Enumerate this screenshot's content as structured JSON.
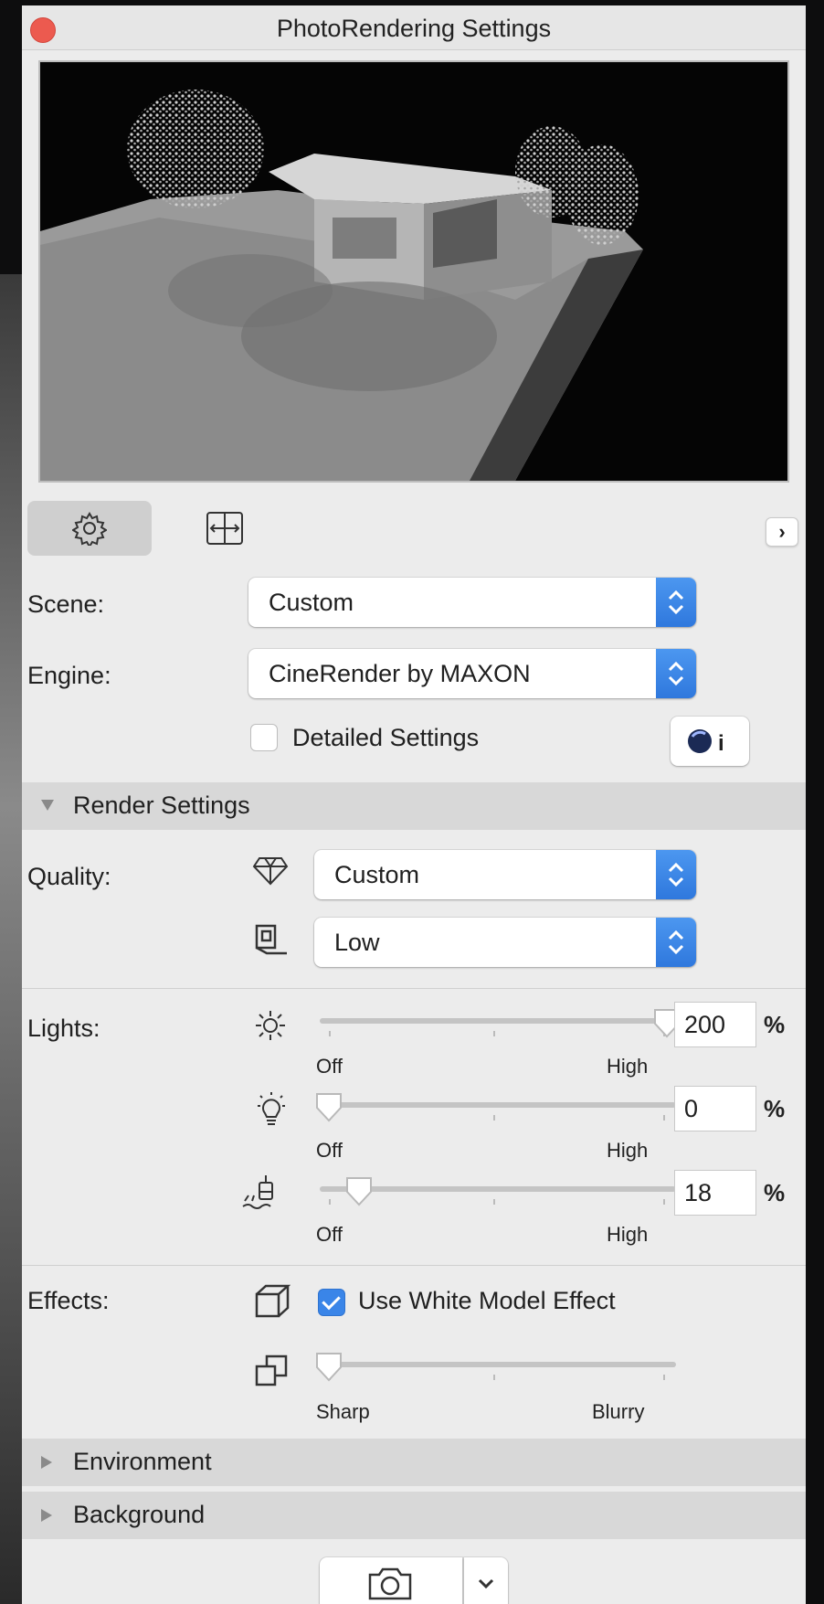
{
  "window": {
    "title": "PhotoRendering Settings"
  },
  "preview": {
    "icon": "architectural-render-preview"
  },
  "tabs": [
    {
      "icon": "gear-icon",
      "active": true
    },
    {
      "icon": "size-frame-icon",
      "active": false
    }
  ],
  "scene": {
    "label": "Scene:",
    "value": "Custom"
  },
  "engine": {
    "label": "Engine:",
    "value": "CineRender by MAXON"
  },
  "detailed_settings": {
    "label": "Detailed Settings",
    "checked": false
  },
  "render_settings": {
    "header": "Render Settings",
    "quality_label": "Quality:",
    "quality_value": "Custom",
    "detail_value": "Low"
  },
  "lights": {
    "label": "Lights:",
    "sun": {
      "value": "200",
      "unit": "%",
      "min_label": "Off",
      "max_label": "High",
      "level": 1.0
    },
    "light": {
      "value": "0",
      "unit": "%",
      "min_label": "Off",
      "max_label": "High",
      "level": 0.0
    },
    "ambient": {
      "value": "18",
      "unit": "%",
      "min_label": "Off",
      "max_label": "High",
      "level": 0.09
    }
  },
  "effects": {
    "label": "Effects:",
    "white_model": {
      "label": "Use White Model Effect",
      "checked": true
    },
    "blur": {
      "min_label": "Sharp",
      "max_label": "Blurry",
      "level": 0.0
    }
  },
  "sections": {
    "environment": "Environment",
    "background": "Background"
  },
  "colors": {
    "accent": "#3a85e8",
    "close": "#ec5a4f",
    "panel": "#ececec"
  }
}
